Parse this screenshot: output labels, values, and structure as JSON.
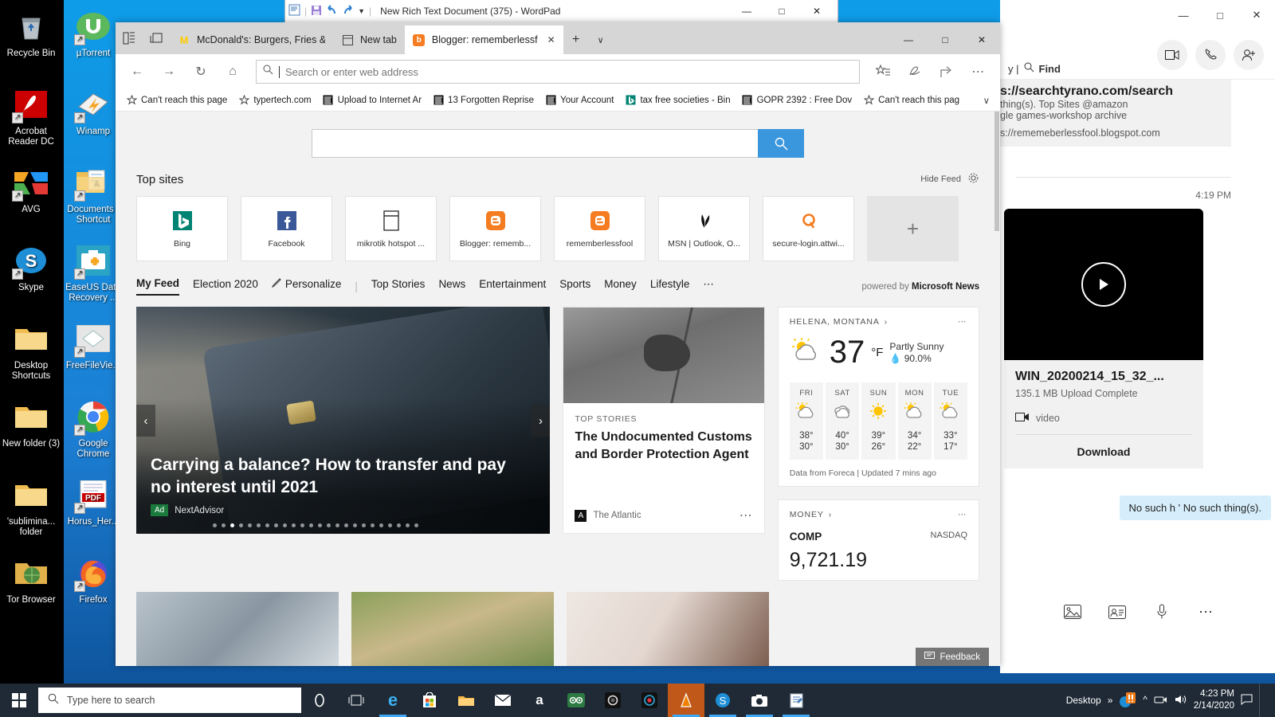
{
  "desktop": {
    "icons_col1": [
      {
        "label": "Recycle Bin",
        "icon": "recycle-bin-icon",
        "shortcut": false
      },
      {
        "label": "Acrobat Reader DC",
        "icon": "acrobat-reader-icon",
        "shortcut": true
      },
      {
        "label": "AVG",
        "icon": "avg-icon",
        "shortcut": true
      },
      {
        "label": "Skype",
        "icon": "skype-icon",
        "shortcut": true
      },
      {
        "label": "Desktop Shortcuts",
        "icon": "folder-icon",
        "shortcut": false
      },
      {
        "label": "New folder (3)",
        "icon": "folder-icon",
        "shortcut": false
      },
      {
        "label": "'sublimina... folder",
        "icon": "folder-icon",
        "shortcut": false
      },
      {
        "label": "Tor Browser",
        "icon": "tor-browser-icon",
        "shortcut": false
      }
    ],
    "icons_col2": [
      {
        "label": "µTorrent",
        "icon": "utorrent-icon",
        "shortcut": true
      },
      {
        "label": "Winamp",
        "icon": "winamp-icon",
        "shortcut": true
      },
      {
        "label": "Documents - Shortcut",
        "icon": "documents-folder-icon",
        "shortcut": true
      },
      {
        "label": "EaseUS Data Recovery ...",
        "icon": "easeus-icon",
        "shortcut": true
      },
      {
        "label": "FreeFileVie...",
        "icon": "freefileviewer-icon",
        "shortcut": true
      },
      {
        "label": "Google Chrome",
        "icon": "chrome-icon",
        "shortcut": true
      },
      {
        "label": "Horus_Her...",
        "icon": "pdf-file-icon",
        "shortcut": true
      },
      {
        "label": "Firefox",
        "icon": "firefox-icon",
        "shortcut": true
      }
    ]
  },
  "wordpad": {
    "title": "New Rich Text Document (375) - WordPad",
    "quick_access": [
      "save-icon",
      "undo-icon",
      "redo-icon",
      "customize-dropdown-icon"
    ],
    "minimize": "—",
    "maximize": "□",
    "close": "✕"
  },
  "skype": {
    "minimize": "—",
    "maximize": "□",
    "close": "✕",
    "find_label": "Find",
    "header_partial": "y  |",
    "link_text": "s://searchtyrano.com/search",
    "sub_line_1": "thing(s).  Top Sites     @amazon",
    "sub_line_2": "gle games-workshop archive",
    "sub_line_3": "s://rememeberlessfool.blogspot.com",
    "time": "4:19 PM",
    "file_name": "WIN_20200214_15_32_...",
    "file_size": "135.1 MB Upload Complete",
    "file_type": "video",
    "download_label": "Download",
    "bubble_text": "No such h ' No such thing(s).",
    "actions": [
      "video-call-icon",
      "audio-call-icon",
      "add-person-icon"
    ],
    "compose_icons": [
      "gallery-icon",
      "contact-card-icon",
      "microphone-icon",
      "more-icon"
    ]
  },
  "browser": {
    "title_icons": [
      "set-tabs-aside-icon",
      "tabs-you-set-aside-icon"
    ],
    "tabs": [
      {
        "label": "McDonald's: Burgers, Fries &",
        "favicon": "mcdonalds-icon",
        "active": false,
        "closable": false
      },
      {
        "label": "New tab",
        "favicon": "newtab-icon",
        "active": false,
        "closable": false
      },
      {
        "label": "Blogger: rememberlessf",
        "favicon": "blogger-icon",
        "active": true,
        "closable": true
      }
    ],
    "new_tab_label": "+",
    "tab_menu_label": "∨",
    "window_controls": {
      "minimize": "—",
      "maximize": "□",
      "close": "✕"
    },
    "nav": {
      "back": "back-arrow-icon",
      "forward": "forward-arrow-icon",
      "refresh": "refresh-icon",
      "home": "home-icon",
      "address_placeholder": "Search or enter web address",
      "address_value": "",
      "right_icons": [
        "favorites-icon",
        "notes-icon",
        "share-icon",
        "more-icon"
      ]
    },
    "favorites": [
      {
        "label": "Can't reach this page",
        "icon": "star-icon"
      },
      {
        "label": "typertech.com",
        "icon": "star-icon"
      },
      {
        "label": "Upload to Internet Ar",
        "icon": "archive-icon"
      },
      {
        "label": "13 Forgotten Reprise",
        "icon": "archive-icon"
      },
      {
        "label": "Your Account",
        "icon": "archive-icon"
      },
      {
        "label": "tax free societies - Bin",
        "icon": "bing-icon"
      },
      {
        "label": "GOPR 2392 : Free Dov",
        "icon": "archive-icon"
      },
      {
        "label": "Can't reach this pag",
        "icon": "star-icon"
      }
    ],
    "favorites_overflow": "∨"
  },
  "newtab": {
    "search": {
      "placeholder": "",
      "value": "",
      "button_icon": "search-icon"
    },
    "top_sites_title": "Top sites",
    "hide_feed_label": "Hide Feed",
    "settings_icon": "gear-icon",
    "tiles": [
      {
        "name": "Bing",
        "icon": "bing-icon"
      },
      {
        "name": "Facebook",
        "icon": "facebook-icon"
      },
      {
        "name": "mikrotik hotspot ...",
        "icon": "generic-page-icon"
      },
      {
        "name": "Blogger: rememb...",
        "icon": "blogger-icon"
      },
      {
        "name": "rememberlessfool",
        "icon": "blogger-icon"
      },
      {
        "name": "MSN | Outlook, O...",
        "icon": "msn-butterfly-icon"
      },
      {
        "name": "secure-login.attwi...",
        "icon": "att-globe-icon"
      },
      {
        "name": "",
        "icon": "add-tile-icon"
      }
    ],
    "feed_nav": {
      "items": [
        "My Feed",
        "Election 2020",
        "Personalize",
        "Top Stories",
        "News",
        "Entertainment",
        "Sports",
        "Money",
        "Lifestyle"
      ],
      "active": "My Feed",
      "personalize_icon": "pencil-icon",
      "more": "⋯",
      "powered_prefix": "powered by",
      "powered_brand": "Microsoft News"
    },
    "hero": {
      "title": "Carrying a balance? How to transfer and pay no interest until 2021",
      "ad_badge": "Ad",
      "source": "NextAdvisor",
      "prev_icon": "chevron-left-icon",
      "next_icon": "chevron-right-icon",
      "dots_total": 24,
      "dots_active_index": 2
    },
    "mid_card": {
      "kicker": "TOP STORIES",
      "title": "The Undocumented Customs and Border Protection Agent",
      "source": "The Atlantic",
      "more": "⋯"
    },
    "weather": {
      "header": "HELENA, MONTANA",
      "chevron": "›",
      "more": "⋯",
      "temp": "37",
      "unit": "°F",
      "condition": "Partly Sunny",
      "humidity": "90.0%",
      "humidity_icon": "water-drop-icon",
      "current_icon": "partly-sunny-icon",
      "forecast": [
        {
          "day": "FRI",
          "icon": "partly-sunny-icon",
          "high": "38°",
          "low": "30°"
        },
        {
          "day": "SAT",
          "icon": "cloudy-icon",
          "high": "40°",
          "low": "30°"
        },
        {
          "day": "SUN",
          "icon": "sunny-icon",
          "high": "39°",
          "low": "26°"
        },
        {
          "day": "MON",
          "icon": "partly-sunny-icon",
          "high": "34°",
          "low": "22°"
        },
        {
          "day": "TUE",
          "icon": "partly-sunny-icon",
          "high": "33°",
          "low": "17°"
        }
      ],
      "footer": "Data from Foreca | Updated 7 mins ago"
    },
    "money": {
      "header": "MONEY",
      "chevron": "›",
      "more": "⋯",
      "symbol": "COMP",
      "exchange": "NASDAQ",
      "value": "9,721.19"
    },
    "feedback_label": "Feedback",
    "feedback_icon": "feedback-icon"
  },
  "taskbar": {
    "start_icon": "windows-start-icon",
    "search_placeholder": "Type here to search",
    "search_icon": "search-icon",
    "buttons": [
      {
        "name": "cortana-icon"
      },
      {
        "name": "task-view-icon"
      },
      {
        "name": "edge-icon",
        "active": true
      },
      {
        "name": "microsoft-store-icon"
      },
      {
        "name": "file-explorer-icon"
      },
      {
        "name": "mail-icon"
      },
      {
        "name": "amazon-icon"
      },
      {
        "name": "tripadvisor-icon"
      },
      {
        "name": "camera-app-icon"
      },
      {
        "name": "photos-icon"
      },
      {
        "name": "vlc-icon",
        "active": true
      },
      {
        "name": "skype-icon",
        "active": true
      },
      {
        "name": "camera-icon",
        "active": true
      },
      {
        "name": "wordpad-icon",
        "active": true
      }
    ],
    "desktop_label": "Desktop",
    "overflow_chevron": "»",
    "tray_icons": [
      "avg-tray-icon",
      "up-chevron-icon",
      "network-icon",
      "volume-icon"
    ],
    "time": "4:23 PM",
    "date": "2/14/2020",
    "action_center_icon": "action-center-icon"
  },
  "colors": {
    "accent_blue": "#3a96dd",
    "taskbar": "#1f2a36",
    "page_bg": "#f2f2f2",
    "tabstrip": "#d6d6d6",
    "blogger_orange": "#f57c20",
    "bing_teal": "#008373",
    "ad_green": "#1a7a3c"
  }
}
